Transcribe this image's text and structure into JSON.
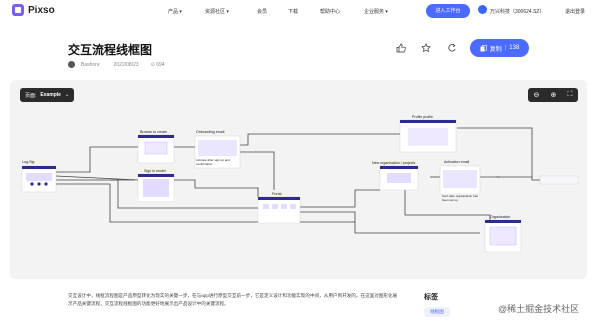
{
  "header": {
    "brand": "Pixso",
    "nav": [
      "产品 ▾",
      "资源社区 ▾",
      "会员",
      "下载",
      "帮助中心",
      "企业服务 ▾"
    ],
    "workspace_button": "进入工作台",
    "org_name": "万兴科技（300624.SZ）",
    "logout": "退出登录"
  },
  "page": {
    "title": "交互流程线框图",
    "author": "Bashore",
    "date": "2022/08/23",
    "views": "⊙ 694",
    "copy_label": "复制",
    "copy_count": "138"
  },
  "canvas": {
    "page_label": "页面:",
    "page_value": "Example",
    "frames": {
      "login": "Log-Sig",
      "browse": "Browse to create",
      "signin": "Sign in model",
      "onboarding": "Onboarding email",
      "onboarding_note": "Activate after sign up and confirmation",
      "portal": "Portal",
      "profile": "Profile profile",
      "new_org": "New organisation / projects",
      "activation": "Activation email",
      "organisation": "Organisation",
      "activation_note": "Sent after organisation has been set up"
    }
  },
  "description": "交互设计中，线框流程图是产品原型转化为现实的关键一步，在与app进行原型交互前一步，它是定义设计和功能实现的中间，从用户到开发的。在这里对图形化展示产品关键流程，交互流程线框图的功能更好地展示出产品设计中的关键流程。",
  "tags": {
    "heading": "标签",
    "items": [
      "线框图"
    ]
  },
  "watermark": "@稀土掘金技术社区",
  "colors": {
    "accent": "#4b6bff",
    "frame_header": "#2d2b8f",
    "canvas_bg": "#f3f3f4"
  }
}
